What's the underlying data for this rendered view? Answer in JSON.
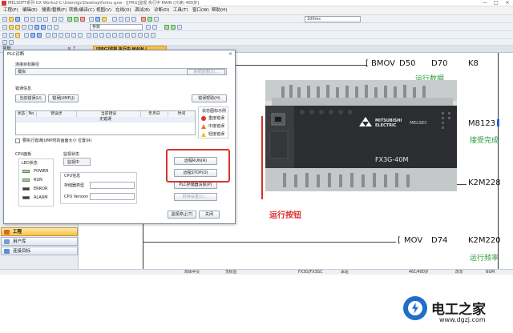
{
  "window": {
    "title": "MELSOFT系列 GX Works2 C:\\Users\\gc\\Desktop\\fxnhu.gxw - [[PRG]监视 执行中 MAIN (只读) 480步]",
    "controls": [
      "—",
      "□",
      "×"
    ]
  },
  "menu": {
    "items": [
      "工程(P)",
      "编辑(E)",
      "搜索/替换(F)",
      "转换/编译(C)",
      "视图(V)",
      "在线(O)",
      "调试(B)",
      "诊断(D)",
      "工具(T)",
      "窗口(W)",
      "帮助(H)"
    ]
  },
  "toolbar": {
    "interval_value": "100ms",
    "param_label": "参数",
    "device_value": ""
  },
  "nav": {
    "header": "导航",
    "pin": "× ⇡",
    "items": [
      {
        "label": "工程",
        "active": true
      },
      {
        "label": "用户库",
        "active": false
      },
      {
        "label": "连接目标",
        "active": false
      }
    ]
  },
  "editor": {
    "tab_label": "[PRG]监视 执行中 MAIN (..."
  },
  "ladder": {
    "rungs": [
      {
        "instr": "BMOV",
        "op1": "D50",
        "op2": "D70",
        "op3": "K8",
        "comment": "运行数据"
      },
      {
        "op3": "M8123",
        "comment": "接受完成"
      },
      {
        "op3": "K2M228"
      },
      {
        "instr": "MOV",
        "op1": "D74",
        "op3": "K2M220",
        "comment": "运行频率"
      }
    ]
  },
  "statusbar": {
    "items": [
      "简体中文",
      "无标签",
      "FX3G/FX3GC",
      "本站",
      "461/480步",
      "改写",
      "NUM"
    ]
  },
  "dialog": {
    "title": "PLC诊断",
    "close": "×",
    "target_label": "连接目标路径",
    "target_value": "模拟",
    "system_image_button": "系统图像(S)...",
    "error_info_label": "错误信息",
    "current_error_button": "当前错误(U)",
    "error_jump_button": "错误JUMP(J)",
    "error_help_button": "错误帮助(H)",
    "columns": [
      "状态",
      "No.",
      "错误步",
      "当前错误",
      "年月日",
      "时间"
    ],
    "no_error_text": "无错误",
    "legend_title": "状态图标示例",
    "legend": [
      "重度错误",
      "中度错误",
      "轻度错误"
    ],
    "jump_checkbox_label": "要执行错误JUMP时的画面大小 位置(R)",
    "cpu_panel_label": "CPU面板",
    "led_group_label": "LED状态",
    "leds": [
      "POWER",
      "RUN",
      "ERROR",
      "ALARM"
    ],
    "monitor_label": "监视状态",
    "monitor_value": "监视中",
    "cpu_info_label": "CPU信息",
    "memory_type_label": "存储器类型",
    "cpu_version_label": "CPU Version",
    "remote_run_button": "远程RUN(R)",
    "remote_stop_button": "远程STOP(O)",
    "memory_clear_button": "PLC存储器清除(P)",
    "clock_button": "时钟设置(C)...",
    "stop_monitor_button": "监视停止(T)",
    "close_button": "关闭",
    "colors": {
      "red_box": "#d9322c",
      "led_on": "#8fe07e"
    }
  },
  "photo": {
    "brand": "MITSUBISHI ELECTRIC",
    "series": "MELSEC",
    "model": "FX3G-40M",
    "caption": "运行按钮"
  },
  "watermark": {
    "name": "电工之家",
    "url": "www.dgzj.com"
  }
}
